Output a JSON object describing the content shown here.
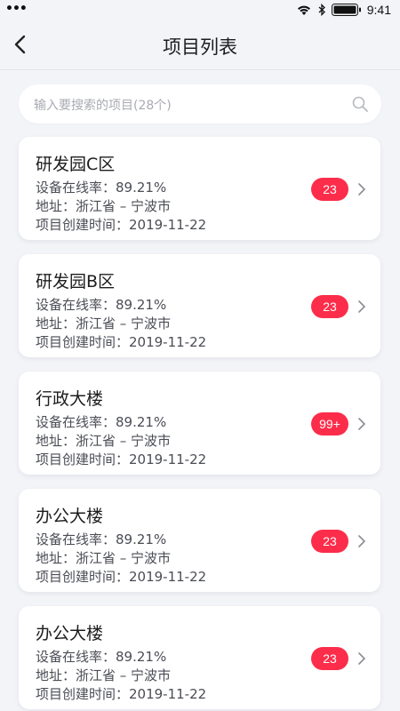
{
  "status_bar": {
    "time": "9:41",
    "left_indicator": "•••"
  },
  "nav": {
    "title": "项目列表",
    "back_icon": "back-arrow-icon"
  },
  "search": {
    "placeholder": "输入要搜索的项目(28个)",
    "icon": "search-icon"
  },
  "projects": [
    {
      "name": "研发园C区",
      "online_rate": "设备在线率：89.21%",
      "address": "地址：浙江省 – 宁波市",
      "created": "项目创建时间：2019-11-22",
      "badge": "23"
    },
    {
      "name": "研发园B区",
      "online_rate": "设备在线率：89.21%",
      "address": "地址：浙江省 – 宁波市",
      "created": "项目创建时间：2019-11-22",
      "badge": "23"
    },
    {
      "name": "行政大楼",
      "online_rate": "设备在线率：89.21%",
      "address": "地址：浙江省 – 宁波市",
      "created": "项目创建时间：2019-11-22",
      "badge": "99+"
    },
    {
      "name": "办公大楼",
      "online_rate": "设备在线率：89.21%",
      "address": "地址：浙江省 – 宁波市",
      "created": "项目创建时间：2019-11-22",
      "badge": "23"
    },
    {
      "name": "办公大楼",
      "online_rate": "设备在线率：89.21%",
      "address": "地址：浙江省 – 宁波市",
      "created": "项目创建时间：2019-11-22",
      "badge": "23"
    }
  ],
  "colors": {
    "background": "#f3f4f8",
    "badge": "#fc2d4a",
    "card": "#ffffff"
  }
}
